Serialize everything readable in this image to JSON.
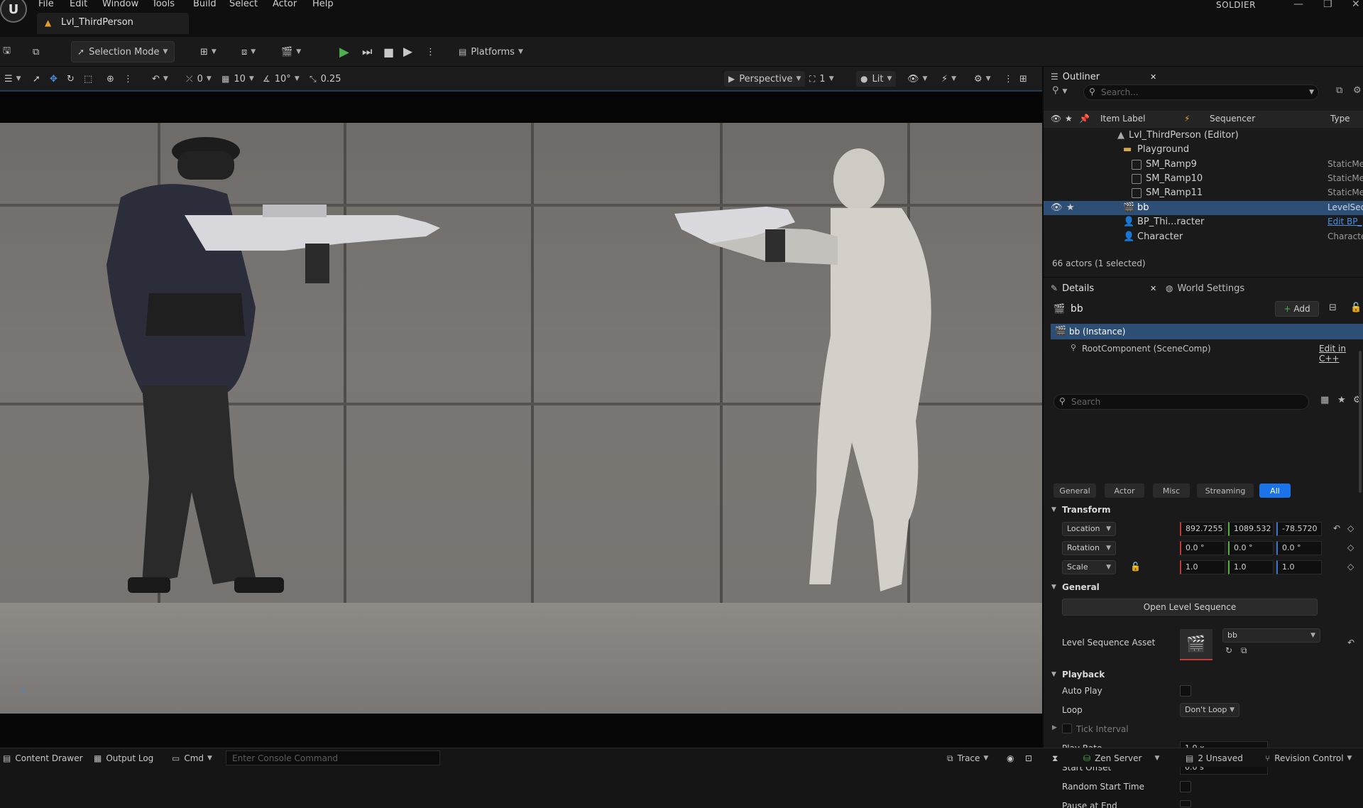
{
  "app": {
    "logo": "U",
    "project": "SOLDIER"
  },
  "menu": [
    "File",
    "Edit",
    "Window",
    "Tools",
    "Build",
    "Select",
    "Actor",
    "Help"
  ],
  "level_tab": {
    "label": "Lvl_ThirdPerson"
  },
  "toolbar": {
    "selection_mode": "Selection Mode",
    "platforms": "Platforms"
  },
  "viewport_bar": {
    "grid_rotate_value": "0",
    "grid_snap_value": "10",
    "rotation_snap_value": "10°",
    "scale_snap_value": "0.25",
    "perspective": "Perspective",
    "camera_speed": "1",
    "view_mode": "Lit"
  },
  "outliner": {
    "tab": "Outliner",
    "search_placeholder": "Search...",
    "columns": {
      "item_label": "Item Label",
      "sequencer": "Sequencer",
      "type": "Type"
    },
    "rows": [
      {
        "label": "Lvl_ThirdPerson (Editor)",
        "type": ""
      },
      {
        "label": "Playground",
        "type": ""
      },
      {
        "label": "SM_Ramp9",
        "type": "StaticMe"
      },
      {
        "label": "SM_Ramp10",
        "type": "StaticMe"
      },
      {
        "label": "SM_Ramp11",
        "type": "StaticMe"
      },
      {
        "label": "bb",
        "type": "LevelSeq"
      },
      {
        "label": "BP_Thi...racter",
        "type": "Edit BP_"
      },
      {
        "label": "Character",
        "type": "Characte"
      }
    ],
    "status": "66 actors (1 selected)"
  },
  "details": {
    "tab": "Details",
    "world_settings_tab": "World Settings",
    "actor_name": "bb",
    "add_button": "Add",
    "instance": "bb (Instance)",
    "root_component": "RootComponent (SceneComp)",
    "edit_cpp": "Edit in C++",
    "search_placeholder": "Search",
    "filter_tabs": [
      "General",
      "Actor",
      "Misc",
      "Streaming",
      "All"
    ],
    "active_filter": "All",
    "transform": {
      "section": "Transform",
      "location_label": "Location",
      "location": [
        "892.7255",
        "1089.532",
        "-78.5720"
      ],
      "rotation_label": "Rotation",
      "rotation": [
        "0.0 °",
        "0.0 °",
        "0.0 °"
      ],
      "scale_label": "Scale",
      "scale": [
        "1.0",
        "1.0",
        "1.0"
      ]
    },
    "general": {
      "section": "General",
      "open_level_sequence": "Open Level Sequence",
      "level_sequence_asset_label": "Level Sequence Asset",
      "level_sequence_asset_value": "bb"
    },
    "playback": {
      "section": "Playback",
      "auto_play_label": "Auto Play",
      "loop_label": "Loop",
      "loop_value": "Don't Loop",
      "tick_interval_label": "Tick Interval",
      "play_rate_label": "Play Rate",
      "play_rate_value": "1.0 x",
      "start_offset_label": "Start Offset",
      "start_offset_value": "0.0 s",
      "random_start_time_label": "Random Start Time",
      "pause_at_end_label": "Pause at End"
    }
  },
  "statusbar": {
    "content_drawer": "Content Drawer",
    "output_log": "Output Log",
    "cmd": "Cmd",
    "console_placeholder": "Enter Console Command",
    "trace": "Trace",
    "zen_server": "Zen Server",
    "unsaved": "2 Unsaved",
    "revision_control": "Revision Control"
  },
  "colors": {
    "accent": "#1a73e8",
    "selection": "#2d4f75",
    "play_green": "#4caf50"
  }
}
